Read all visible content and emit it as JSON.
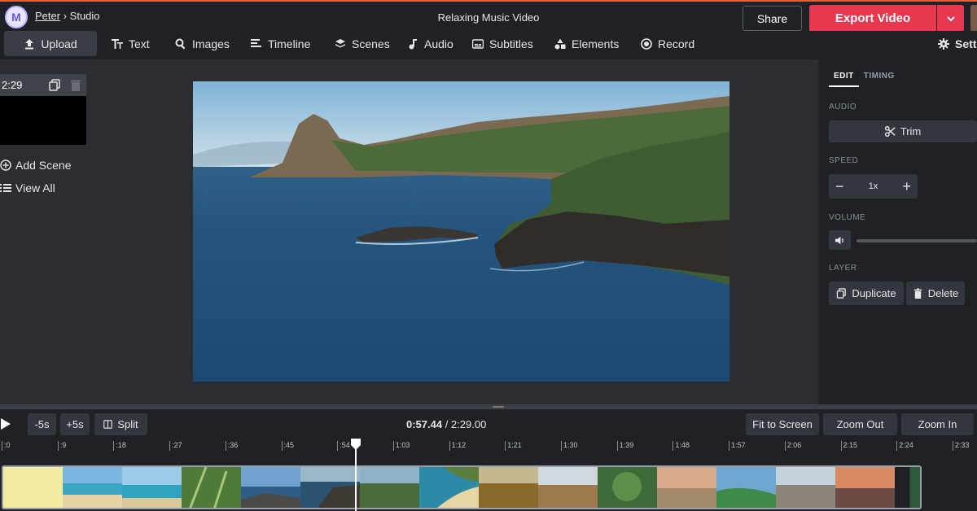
{
  "header": {
    "user": "Peter",
    "separator": "›",
    "section": "Studio",
    "title": "Relaxing Music Video",
    "share_label": "Share",
    "export_label": "Export Video"
  },
  "toolbar": {
    "items": [
      {
        "label": "Upload",
        "icon": "upload-icon"
      },
      {
        "label": "Text",
        "icon": "text-icon"
      },
      {
        "label": "Images",
        "icon": "search-icon"
      },
      {
        "label": "Timeline",
        "icon": "timeline-icon"
      },
      {
        "label": "Scenes",
        "icon": "layers-icon"
      },
      {
        "label": "Audio",
        "icon": "music-note-icon"
      },
      {
        "label": "Subtitles",
        "icon": "subtitles-icon"
      },
      {
        "label": "Elements",
        "icon": "shapes-icon"
      },
      {
        "label": "Record",
        "icon": "record-icon"
      }
    ],
    "settings_label": "Setti"
  },
  "left_panel": {
    "scene_duration": "2:29",
    "add_scene_label": "Add Scene",
    "view_all_label": "View All"
  },
  "right_panel": {
    "tabs": [
      "EDIT",
      "TIMING"
    ],
    "active_tab": "EDIT",
    "audio_label": "AUDIO",
    "trim_label": "Trim",
    "speed_label": "SPEED",
    "speed_value": "1x",
    "volume_label": "VOLUME",
    "layer_label": "LAYER",
    "duplicate_label": "Duplicate",
    "delete_label": "Delete"
  },
  "timeline": {
    "back_label": "-5s",
    "forward_label": "+5s",
    "split_label": "Split",
    "current_time": "0:57.44",
    "total_time": " / 2:29.00",
    "fit_label": "Fit to Screen",
    "zoom_out_label": "Zoom Out",
    "zoom_in_label": "Zoom In",
    "ruler_ticks": [
      ":0",
      ":9",
      ":18",
      ":27",
      ":36",
      ":45",
      ":54",
      "1:03",
      "1:12",
      "1:21",
      "1:30",
      "1:39",
      "1:48",
      "1:57",
      "2:06",
      "2:15",
      "2:24",
      "2:33"
    ]
  },
  "colors": {
    "accent": "#e8384f",
    "topbar_bg": "#1f2126",
    "workspace_bg": "#2b2d33"
  }
}
